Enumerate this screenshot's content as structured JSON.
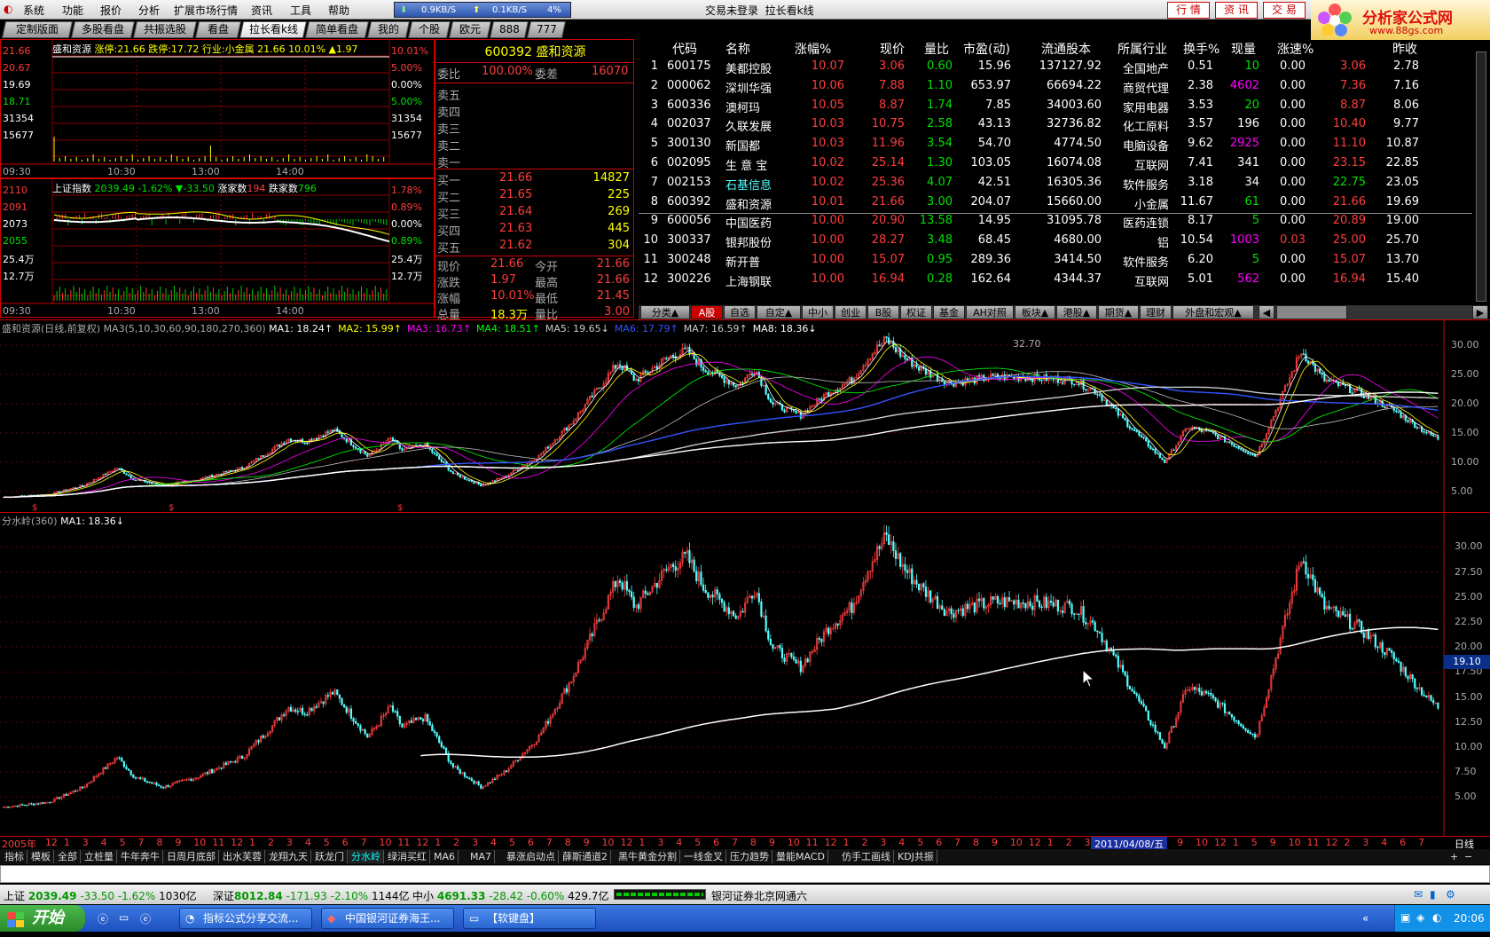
{
  "menu": [
    "系统",
    "功能",
    "报价",
    "分析",
    "扩展市场行情",
    "资讯",
    "工具",
    "帮助"
  ],
  "net": {
    "down": "0.9KB/S",
    "up": "0.1KB/S",
    "pct": "4%"
  },
  "title": {
    "login": "交易未登录",
    "view": "拉长看k线"
  },
  "right_buttons": [
    "行 情",
    "资 讯",
    "交 易"
  ],
  "logo": {
    "text": "分析家公式网",
    "url": "www.88gs.com"
  },
  "tabs": [
    {
      "label": "定制版面",
      "active": false
    },
    {
      "label": "多股看盘",
      "active": false
    },
    {
      "label": "共振选股",
      "active": false
    },
    {
      "label": "看盘",
      "active": false
    },
    {
      "label": "拉长看k线",
      "active": true
    },
    {
      "label": "简单看盘",
      "active": false
    },
    {
      "label": "我的",
      "active": false
    },
    {
      "label": "个股",
      "active": false
    },
    {
      "label": "欧元",
      "active": false
    },
    {
      "label": "888",
      "active": false
    },
    {
      "label": "777",
      "active": false
    }
  ],
  "mini1": {
    "header_name": "盛和资源",
    "header_rest": " 涨停:21.66 跌停:17.72 行业:小金属 21.66 10.01% ▲1.97",
    "left_axis": [
      "21.66",
      "20.67",
      "19.69",
      "18.71",
      "31354",
      "15677"
    ],
    "right_axis": [
      "10.01%",
      "5.00%",
      "0.00%",
      "5.00%",
      "31354",
      "15677"
    ],
    "times": [
      "09:30",
      "10:30",
      "13:00",
      "14:00"
    ]
  },
  "mini2": {
    "header_name": "上证指数",
    "header_val": "2039.49 -1.62% ▼-33.50",
    "up_label": "涨家数",
    "up": "194",
    "down_label": "跌家数",
    "down": "796",
    "left_axis": [
      "2110",
      "2091",
      "2073",
      "2055",
      "25.4万",
      "12.7万"
    ],
    "right_axis": [
      "1.78%",
      "0.89%",
      "0.00%",
      "0.89%",
      "25.4万",
      "12.7万"
    ],
    "times": [
      "09:30",
      "10:30",
      "13:00",
      "14:00"
    ]
  },
  "quote": {
    "code_name": "600392 盛和资源",
    "weibi_label": "委比",
    "weibi": "100.00%",
    "weicha_label": "委差",
    "weicha": "16070",
    "sell": [
      "卖五",
      "卖四",
      "卖三",
      "卖二",
      "卖一"
    ],
    "buy": [
      {
        "label": "买一",
        "price": "21.66",
        "vol": "14827"
      },
      {
        "label": "买二",
        "price": "21.65",
        "vol": "225"
      },
      {
        "label": "买三",
        "price": "21.64",
        "vol": "269"
      },
      {
        "label": "买四",
        "price": "21.63",
        "vol": "445"
      },
      {
        "label": "买五",
        "price": "21.62",
        "vol": "304"
      }
    ],
    "stats": [
      {
        "l1": "现价",
        "v1": "21.66",
        "l2": "今开",
        "v2": "21.66"
      },
      {
        "l1": "涨跌",
        "v1": "1.97",
        "l2": "最高",
        "v2": "21.66"
      },
      {
        "l1": "涨幅",
        "v1": "10.01%",
        "l2": "最低",
        "v2": "21.45"
      },
      {
        "l1": "总量",
        "v1": "18.3万",
        "l2": "量比",
        "v2": "3.00"
      }
    ]
  },
  "rank": {
    "headers": [
      "代码",
      "名称",
      "涨幅%",
      "现价",
      "量比",
      "市盈(动)",
      "流通股本",
      "所属行业",
      "换手%",
      "现量",
      "涨速%",
      "",
      "昨收"
    ],
    "rows": [
      [
        "1",
        "600175",
        "美都控股",
        "10.07",
        "3.06",
        "0.60",
        "15.96",
        "137127.92",
        "全国地产",
        "0.51",
        "10",
        "0.00",
        "3.06",
        "2.78"
      ],
      [
        "2",
        "000062",
        "深圳华强",
        "10.06",
        "7.88",
        "1.10",
        "653.97",
        "66694.22",
        "商贸代理",
        "2.38",
        "4602",
        "0.00",
        "7.36",
        "7.16"
      ],
      [
        "3",
        "600336",
        "澳柯玛",
        "10.05",
        "8.87",
        "1.74",
        "7.85",
        "34003.60",
        "家用电器",
        "3.53",
        "20",
        "0.00",
        "8.87",
        "8.06"
      ],
      [
        "4",
        "002037",
        "久联发展",
        "10.03",
        "10.75",
        "2.58",
        "43.13",
        "32736.82",
        "化工原料",
        "3.57",
        "196",
        "0.00",
        "10.40",
        "9.77"
      ],
      [
        "5",
        "300130",
        "新国都",
        "10.03",
        "11.96",
        "3.54",
        "54.70",
        "4774.50",
        "电脑设备",
        "9.62",
        "2925",
        "0.00",
        "11.10",
        "10.87"
      ],
      [
        "6",
        "002095",
        "生 意 宝",
        "10.02",
        "25.14",
        "1.30",
        "103.05",
        "16074.08",
        "互联网",
        "7.41",
        "341",
        "0.00",
        "23.15",
        "22.85"
      ],
      [
        "7",
        "002153",
        "石基信息",
        "10.02",
        "25.36",
        "4.07",
        "42.51",
        "16305.36",
        "软件服务",
        "3.18",
        "34",
        "0.00",
        "22.75",
        "23.05"
      ],
      [
        "8",
        "600392",
        "盛和资源",
        "10.01",
        "21.66",
        "3.00",
        "204.07",
        "15660.00",
        "小金属",
        "11.67",
        "61",
        "0.00",
        "21.66",
        "19.69"
      ],
      [
        "9",
        "600056",
        "中国医药",
        "10.00",
        "20.90",
        "13.58",
        "14.95",
        "31095.78",
        "医药连锁",
        "8.17",
        "5",
        "0.00",
        "20.89",
        "19.00"
      ],
      [
        "10",
        "300337",
        "银邦股份",
        "10.00",
        "28.27",
        "3.48",
        "68.45",
        "4680.00",
        "铝",
        "10.54",
        "1003",
        "0.03",
        "25.00",
        "25.70"
      ],
      [
        "11",
        "300248",
        "新开普",
        "10.00",
        "15.07",
        "0.95",
        "289.36",
        "3414.50",
        "软件服务",
        "6.20",
        "5",
        "0.00",
        "15.07",
        "13.70"
      ],
      [
        "12",
        "300226",
        "上海钢联",
        "10.00",
        "16.94",
        "0.28",
        "162.64",
        "4344.37",
        "互联网",
        "5.01",
        "562",
        "0.00",
        "16.94",
        "15.40"
      ]
    ]
  },
  "categories": [
    "分类▲",
    "A股",
    "自选",
    "自定▲",
    "中小",
    "创业",
    "B股",
    "权证",
    "基金",
    "AH对照",
    "板块▲",
    "港股▲",
    "期货▲",
    "理财",
    "外盘和宏观▲"
  ],
  "kline": {
    "label_name": "盛和资源(日线,前复权) MA3(5,10,30,60,90,180,270,360)",
    "ma": [
      {
        "t": "MA1: 18.24↑",
        "c": "#ffffff"
      },
      {
        "t": "MA2: 15.99↑",
        "c": "#ffff00"
      },
      {
        "t": "MA3: 16.73↑",
        "c": "#ff00ff"
      },
      {
        "t": "MA4: 18.51↑",
        "c": "#00ff00"
      },
      {
        "t": "MA5: 19.65↓",
        "c": "#cccccc"
      },
      {
        "t": "MA6: 17.79↑",
        "c": "#3355ff"
      },
      {
        "t": "MA7: 16.59↑",
        "c": "#cccccc"
      },
      {
        "t": "MA8: 18.36↓",
        "c": "#ffffff"
      }
    ],
    "axis": [
      "30.00",
      "25.00",
      "20.00",
      "15.00",
      "10.00",
      "5.00"
    ],
    "high_label": "32.70"
  },
  "sub": {
    "label": "分水岭(360)",
    "ma": "MA1: 18.36↓",
    "axis": [
      "30.00",
      "27.50",
      "25.00",
      "22.50",
      "20.00",
      "17.50",
      "15.00",
      "12.50",
      "10.00",
      "7.50",
      "5.00"
    ],
    "cursor_value": "19.10"
  },
  "timeline": {
    "labels": [
      "2005年",
      "12",
      "1",
      "3",
      "4",
      "5",
      "7",
      "8",
      "9",
      "10",
      "11",
      "12",
      "1",
      "2",
      "3",
      "4",
      "5",
      "6",
      "7",
      "10",
      "11",
      "12",
      "1",
      "2",
      "3",
      "4",
      "5",
      "6",
      "7",
      "8",
      "9",
      "10",
      "12",
      "1",
      "3",
      "4",
      "5",
      "6",
      "7",
      "8",
      "9",
      "10",
      "11",
      "12",
      "1",
      "2",
      "3",
      "4",
      "5",
      "6",
      "7",
      "8",
      "9",
      "10",
      "12",
      "1",
      "2",
      "3",
      "4",
      "5",
      "6",
      "7",
      "9",
      "10",
      "12",
      "1",
      "5",
      "9",
      "10",
      "11",
      "12",
      "2",
      "3",
      "4",
      "6",
      "7"
    ],
    "date": "2011/04/08/五",
    "period": "日线"
  },
  "indicators": [
    "指标",
    "模板",
    "全部",
    "立桩量",
    "牛年奔牛",
    "日周月底部",
    "出水芙蓉",
    "龙翔九天",
    "跃龙门",
    "分水岭",
    "绿消买红",
    "MA6",
    "MA7",
    "暴涨启动点",
    "薛斯通道2",
    "黑牛黄金分割",
    "一线金叉",
    "压力趋势",
    "量能MACD",
    "仿手工画线",
    "KDJ共振"
  ],
  "active_indicator": "分水岭",
  "status": {
    "sh_label": "上证",
    "sh": "2039.49",
    "sh_chg": "-33.50",
    "sh_pct": "-1.62%",
    "sh_amt": "1030亿",
    "sz_label": "深证",
    "sz": "8012.84",
    "sz_chg": "-171.93",
    "sz_pct": "-2.10%",
    "sz_amt": "1144亿",
    "zx_label": "中小",
    "zx": "4691.33",
    "zx_chg": "-28.42",
    "zx_pct": "-0.60%",
    "zx_amt": "429.7亿",
    "broker": "银河证券北京网通六"
  },
  "taskbar": {
    "start": "开始",
    "tasks": [
      "指标公式分享交流...",
      "中国银河证券海王...",
      "【软键盘】"
    ],
    "clock": "20:06"
  },
  "colors": {
    "up": "#ff3c3c",
    "down": "#00e000",
    "border": "#cc0000",
    "active_tab": "#ffffff"
  }
}
